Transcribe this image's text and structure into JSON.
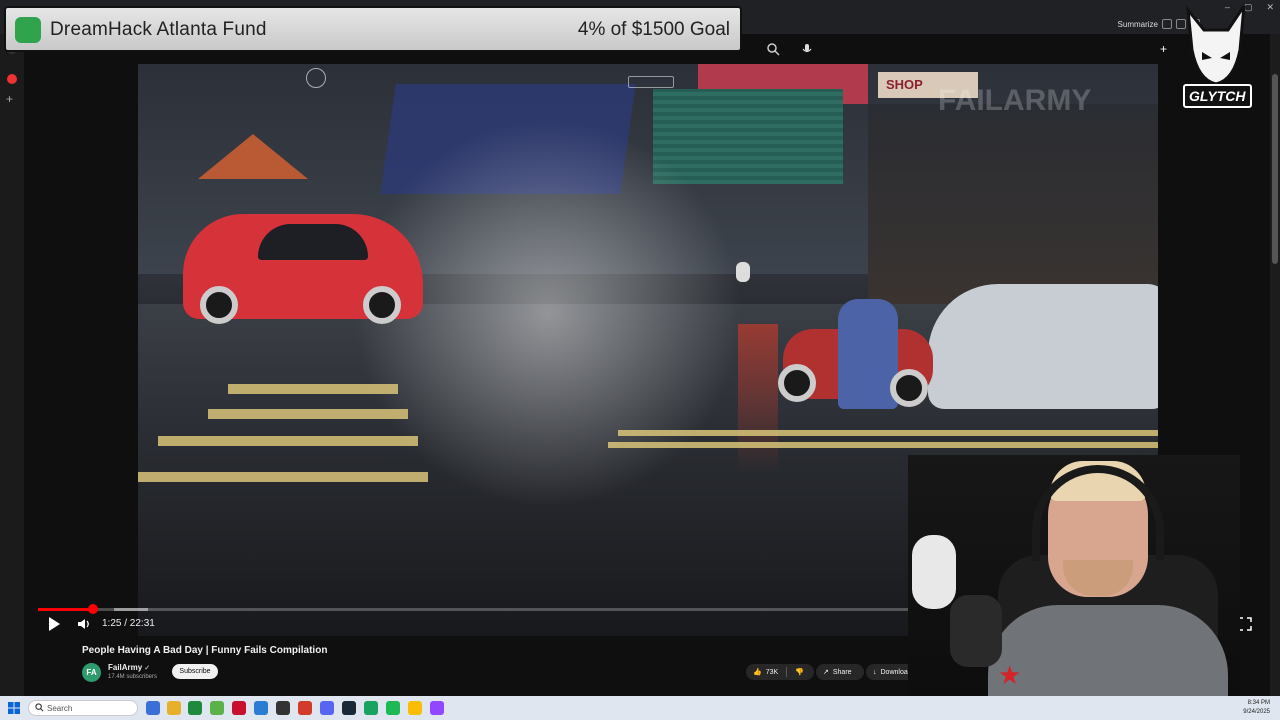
{
  "browser": {
    "summarize_label": "Summarize"
  },
  "fund_overlay": {
    "title": "DreamHack Atlanta Fund",
    "goal_text": "4% of $1500 Goal",
    "percent": 4,
    "goal_amount": 1500
  },
  "video": {
    "watermark": "FAILARMY",
    "shop_sign": "SHOP",
    "progress_fraction": 0.0634
  },
  "player": {
    "time_display": "1:25 / 22:31"
  },
  "video_info": {
    "title": "People Having A Bad Day | Funny Fails Compilation",
    "channel_name": "FailArmy",
    "channel_avatar_text": "FA",
    "verified_mark": "✓",
    "subscribers": "17.4M subscribers",
    "subscribe_label": "Subscribe",
    "likes": "73K",
    "share_label": "Share",
    "download_label": "Download"
  },
  "overlay": {
    "logo_text": "GLYTCH"
  },
  "taskbar": {
    "search_placeholder": "Search",
    "time": "8:34 PM",
    "date": "9/24/2025"
  },
  "colors": {
    "accent": "#ff0000",
    "fund_bg": "#d9d9d9",
    "channel_avatar": "#2e9b6e"
  }
}
